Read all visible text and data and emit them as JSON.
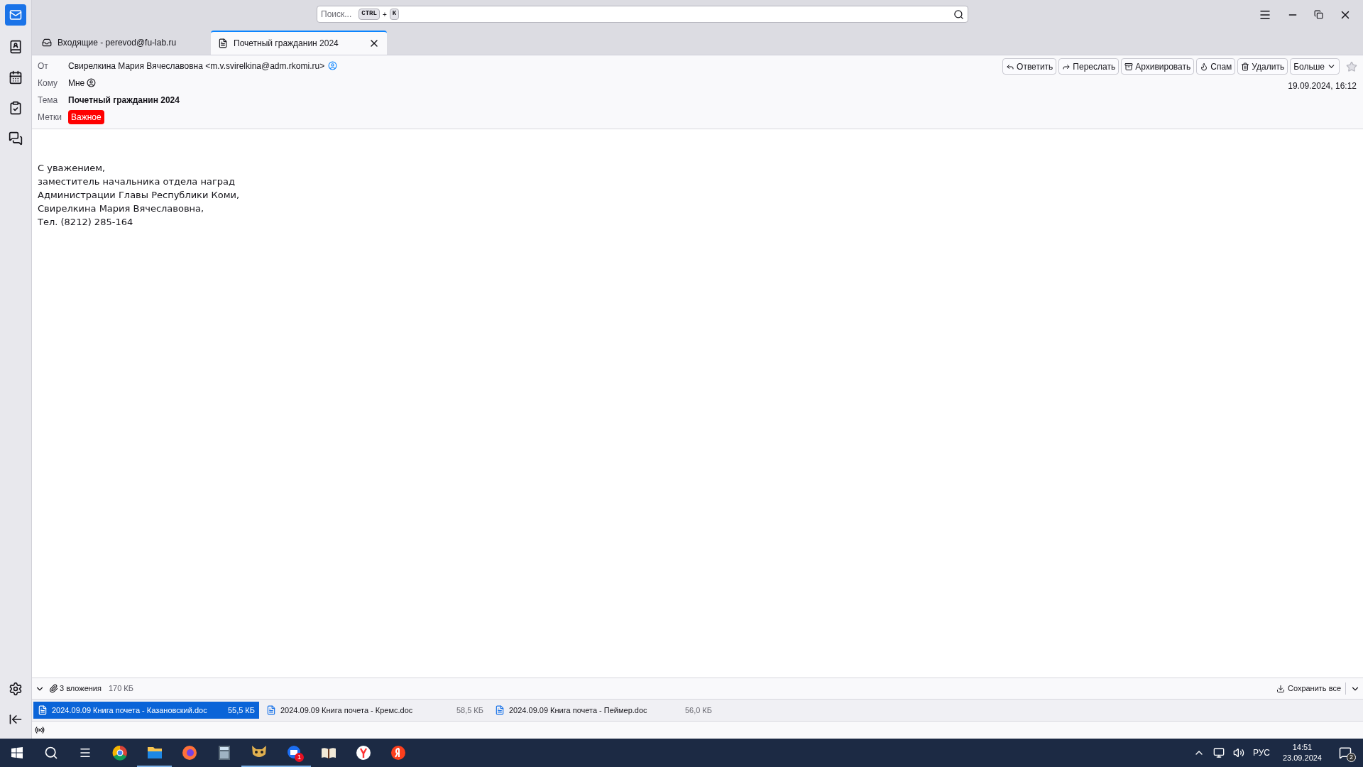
{
  "search": {
    "placeholder": "Поиск...",
    "shortcut_keys": [
      "CTRL",
      "K"
    ],
    "plus": "+"
  },
  "tabs": [
    {
      "label": "Входящие - perevod@fu-lab.ru",
      "kind": "folder",
      "selected": false
    },
    {
      "label": "Почетный гражданин 2024",
      "kind": "message",
      "selected": true
    }
  ],
  "header": {
    "fields": [
      {
        "label": "От",
        "value": "Свирелкина Мария Вячеславовна <m.v.svirelkina@adm.rkomi.ru>",
        "kind": "from"
      },
      {
        "label": "Кому",
        "value": "Мне",
        "kind": "to"
      },
      {
        "label": "Тема",
        "value": "Почетный гражданин 2024",
        "kind": "subject"
      },
      {
        "label": "Метки",
        "value": "Важное",
        "kind": "tag",
        "color": "#ff0000"
      }
    ],
    "actions": [
      {
        "label": "Ответить",
        "kind": "reply"
      },
      {
        "label": "Переслать",
        "kind": "forward"
      },
      {
        "label": "Архивировать",
        "kind": "archive"
      },
      {
        "label": "Спам",
        "kind": "spam"
      },
      {
        "label": "Удалить",
        "kind": "delete"
      },
      {
        "label": "Больше",
        "kind": "more"
      }
    ],
    "starred": false,
    "date": "19.09.2024, 16:12"
  },
  "body": [
    "С уважением,",
    "заместитель начальника отдела наград",
    "Администрации Главы Республики Коми,",
    "Свирелкина Мария Вячеславовна,",
    "Тел. (8212) 285-164"
  ],
  "attachments": {
    "expanded": true,
    "count": "3 вложения",
    "total": "170 КБ",
    "save_all": "Сохранить все",
    "items": [
      {
        "name": "2024.09.09 Книга почета - Казановский.doc",
        "size": "55,5 КБ",
        "selected": true
      },
      {
        "name": "2024.09.09 Книга почета - Кремс.doc",
        "size": "58,5 КБ",
        "selected": false
      },
      {
        "name": "2024.09.09 Книга почета - Пеймер.doc",
        "size": "56,0 КБ",
        "selected": false
      }
    ]
  },
  "taskbar": {
    "apps": [
      {
        "kind": "chrome",
        "active": false
      },
      {
        "kind": "explorer",
        "active": true
      },
      {
        "kind": "firefox",
        "active": false
      },
      {
        "kind": "calculator",
        "active": false
      },
      {
        "kind": "cat",
        "active": true
      },
      {
        "kind": "thunderbird",
        "active": true,
        "badge": "1"
      },
      {
        "kind": "book",
        "active": false
      },
      {
        "kind": "yandex-browser",
        "active": false
      },
      {
        "kind": "yandex",
        "active": false
      }
    ],
    "language": "РУС",
    "time": "14:51",
    "date": "23.09.2024",
    "notifications": "2"
  }
}
